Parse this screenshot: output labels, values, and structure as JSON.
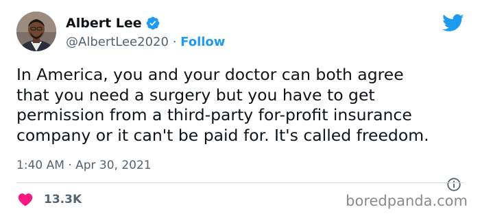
{
  "author": {
    "name": "Albert Lee",
    "handle": "@AlbertLee2020",
    "separator": "·",
    "follow_label": "Follow",
    "verified_icon": "verified-badge-icon"
  },
  "tweet": {
    "lines": [
      "In America, you and your doctor can both agree",
      "that you need a surgery but you have to get",
      "permission from a third-party for-profit insurance",
      "company or it can't be paid for. It's called freedom."
    ],
    "timestamp": "1:40 AM · Apr 30, 2021",
    "like_count": "13.3K"
  },
  "watermark": "boredpanda.com",
  "colors": {
    "accent": "#1d9bf0",
    "like": "#f91880",
    "muted": "#536471",
    "text": "#0f1419",
    "divider": "#cfd9de"
  },
  "icons": {
    "logo": "twitter-bird-icon",
    "info": "info-icon",
    "like": "heart-icon"
  }
}
